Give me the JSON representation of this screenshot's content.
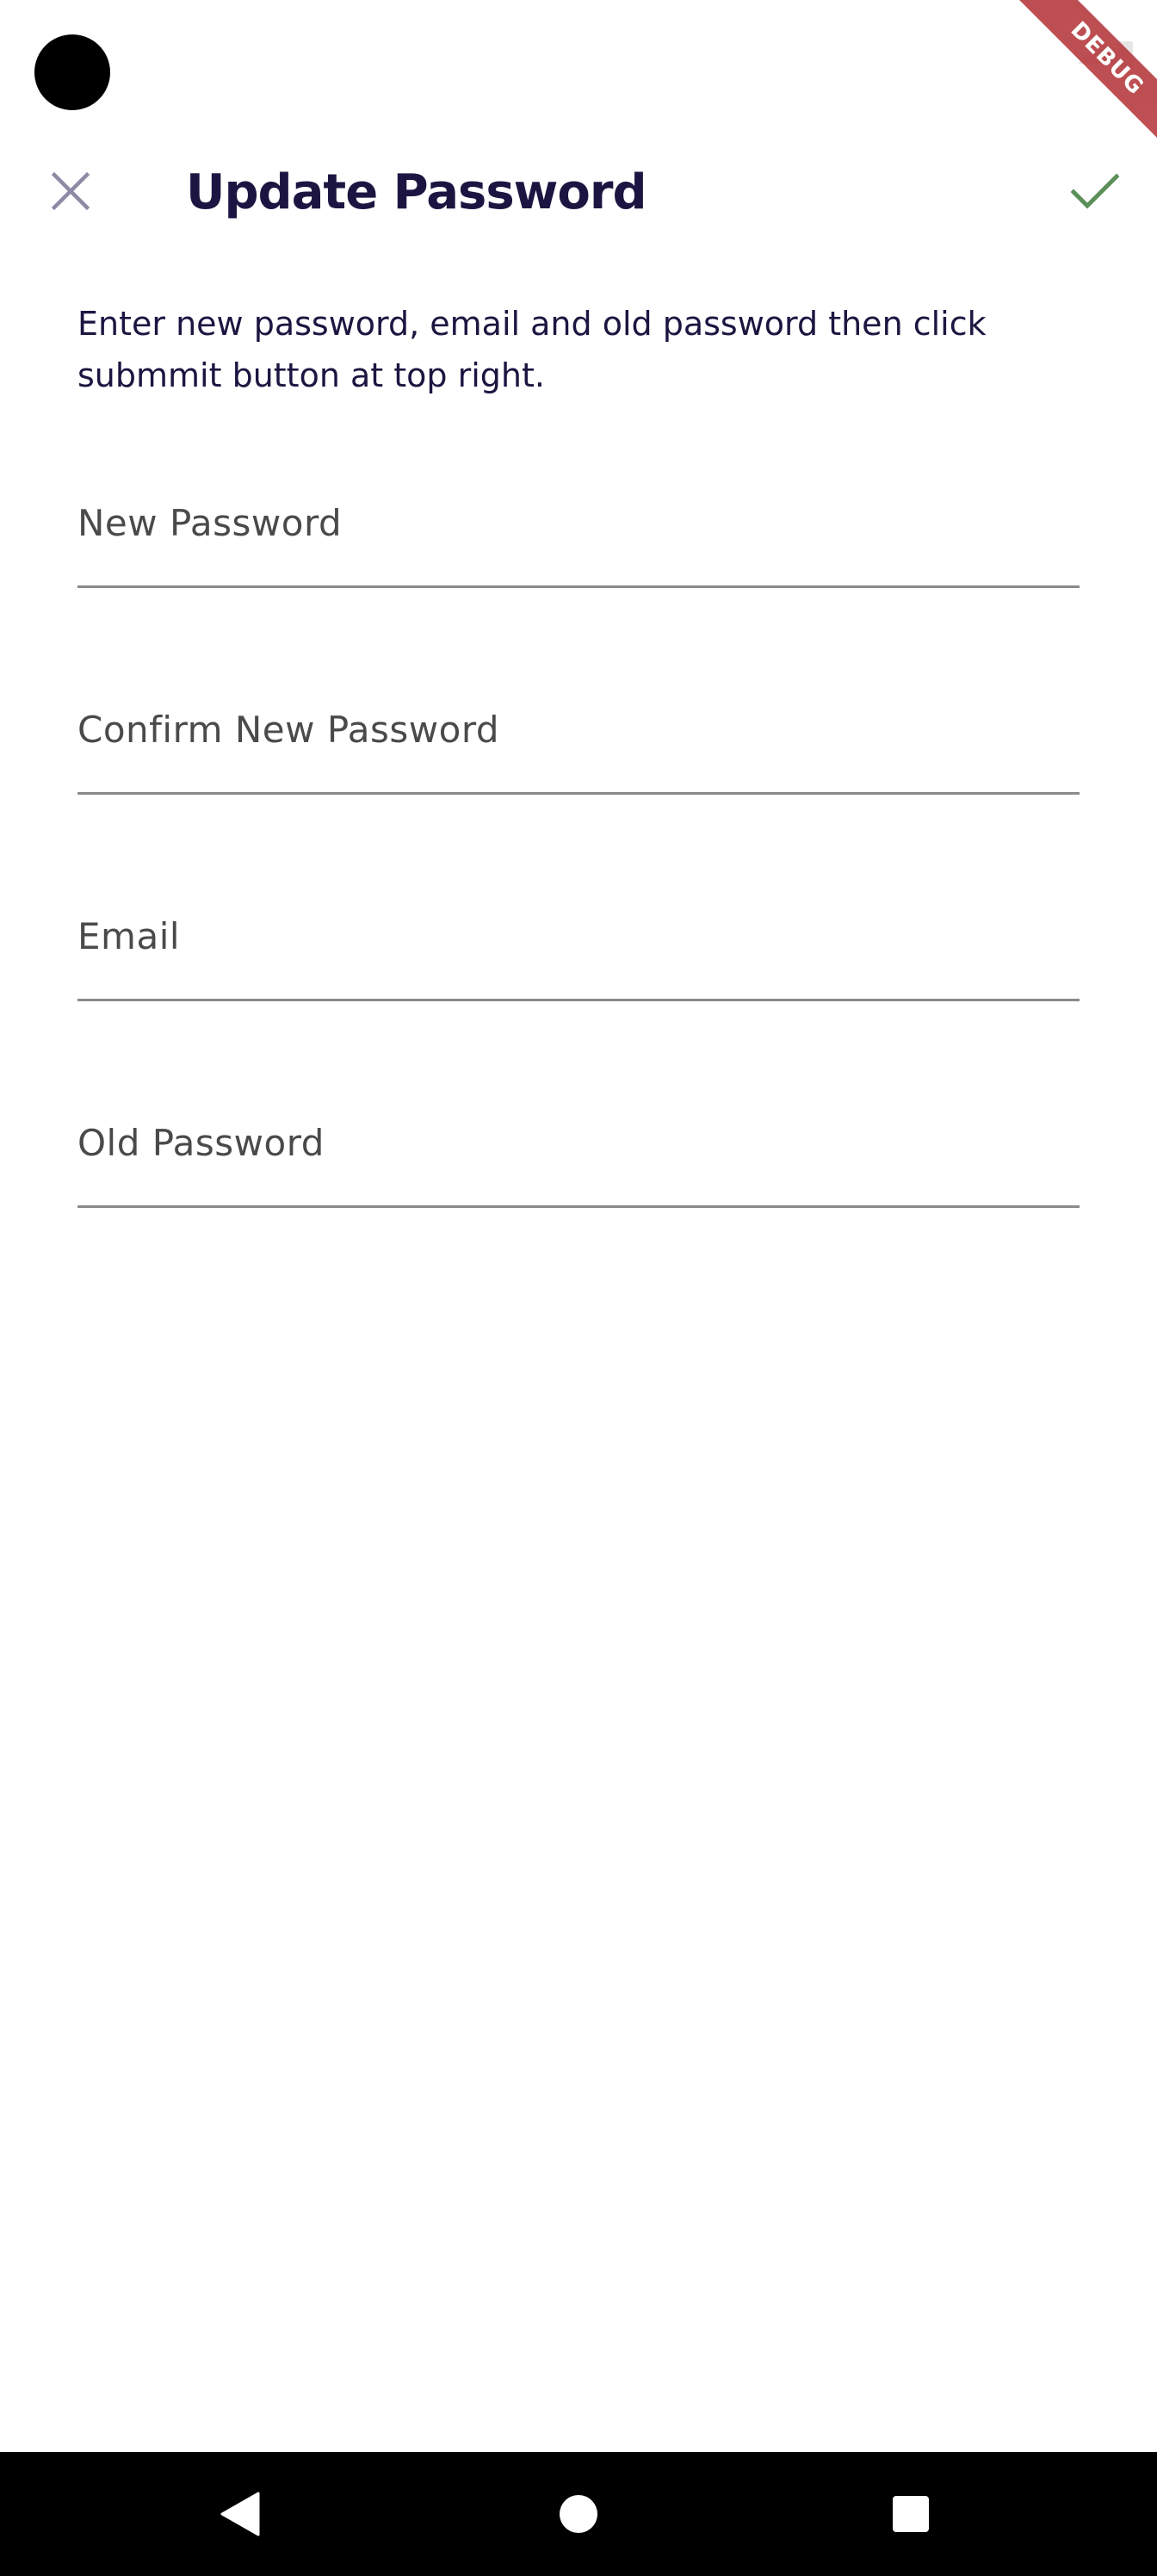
{
  "status_bar": {
    "debug_banner": "DEBUG"
  },
  "app_bar": {
    "title": "Update Password",
    "close_icon": "close-icon",
    "submit_icon": "check-icon",
    "accent_color": "#5a8f5a",
    "close_color": "#8e8aa6"
  },
  "form": {
    "instructions": "Enter new password, email and old password then click submmit button at top right.",
    "fields": [
      {
        "label": "New Password",
        "value": ""
      },
      {
        "label": "Confirm New Password",
        "value": ""
      },
      {
        "label": "Email",
        "value": ""
      },
      {
        "label": "Old Password",
        "value": ""
      }
    ]
  },
  "nav_bar": {
    "back_icon": "back-triangle-icon",
    "home_icon": "home-circle-icon",
    "recents_icon": "recents-square-icon"
  }
}
